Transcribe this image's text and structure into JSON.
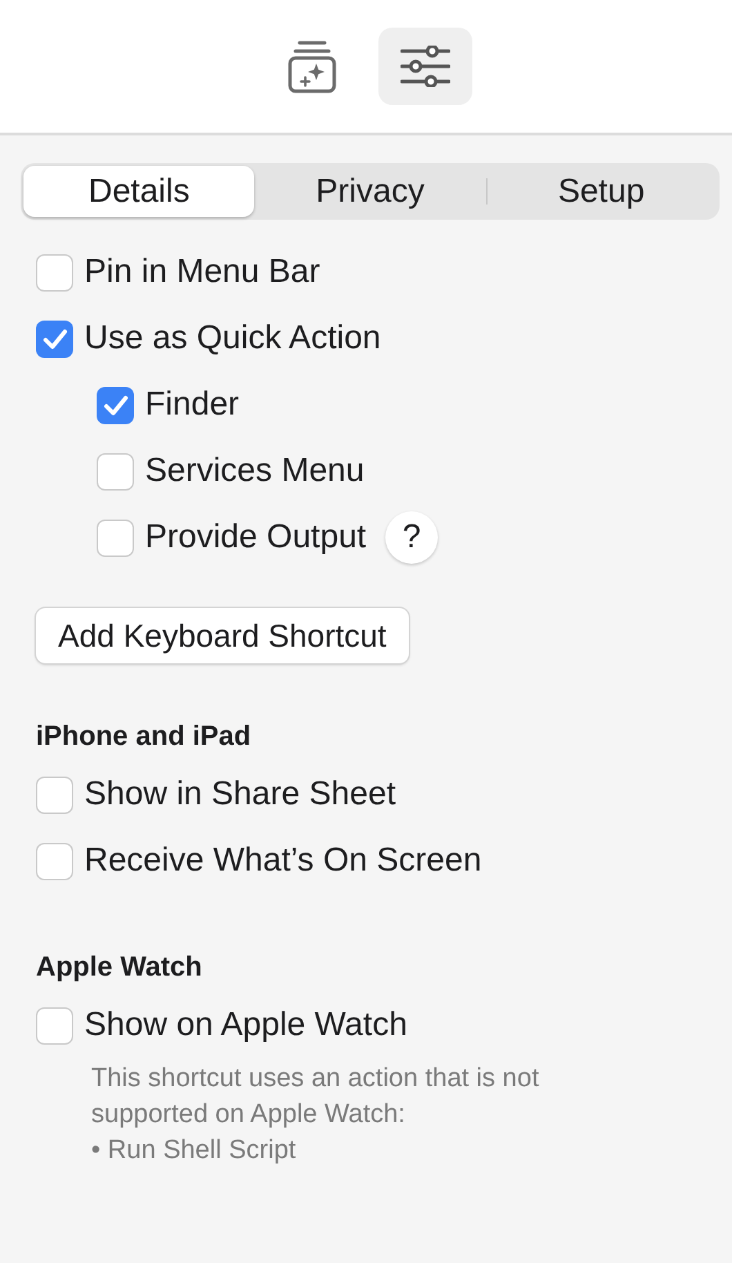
{
  "toolbar": [
    {
      "kind": "sparkle",
      "selected": false
    },
    {
      "kind": "sliders",
      "selected": true
    }
  ],
  "tabs": [
    {
      "label": "Details",
      "selected": true
    },
    {
      "label": "Privacy",
      "selected": false
    },
    {
      "label": "Setup",
      "selected": false
    }
  ],
  "options": [
    {
      "label": "Pin in Menu Bar",
      "checked": false
    },
    {
      "label": "Use as Quick Action",
      "checked": true,
      "children": [
        {
          "label": "Finder",
          "checked": true
        },
        {
          "label": "Services Menu",
          "checked": false
        },
        {
          "label": "Provide Output",
          "checked": false,
          "help": "?"
        }
      ]
    }
  ],
  "shortcut_button": "Add Keyboard Shortcut",
  "sections": [
    {
      "title": "iPhone and iPad",
      "options": [
        {
          "label": "Show in Share Sheet",
          "checked": false
        },
        {
          "label": "Receive What’s On Screen",
          "checked": false
        }
      ]
    },
    {
      "title": "Apple Watch",
      "options": [
        {
          "label": "Show on Apple Watch",
          "checked": false
        }
      ],
      "note": [
        "This shortcut uses an action that is not supported on Apple Watch:",
        "• Run Shell Script"
      ]
    }
  ]
}
